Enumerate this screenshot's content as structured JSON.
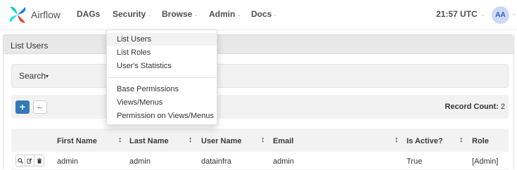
{
  "app": {
    "brand": "Airflow",
    "accent_color": "#017cee"
  },
  "navbar": {
    "items": [
      {
        "label": "DAGs",
        "caret": false
      },
      {
        "label": "Security",
        "caret": true
      },
      {
        "label": "Browse",
        "caret": true
      },
      {
        "label": "Admin",
        "caret": true
      },
      {
        "label": "Docs",
        "caret": true
      }
    ],
    "clock": "21:57 UTC",
    "user_initials": "AA"
  },
  "security_menu": {
    "items": [
      "List Users",
      "List Roles",
      "User's Statistics",
      "Base Permissions",
      "Views/Menus",
      "Permission on Views/Menus"
    ],
    "highlighted": "List Users"
  },
  "page": {
    "title": "List Users",
    "search_label": "Search",
    "add_icon": "plus-icon",
    "back_icon": "arrow-left-icon",
    "record_count_label": "Record Count:",
    "record_count": "2"
  },
  "table": {
    "columns": [
      "First Name",
      "Last Name",
      "User Name",
      "Email",
      "Is Active?",
      "Role"
    ],
    "rows": [
      {
        "first_name": "admin",
        "last_name": "admin",
        "user_name": "datainfra",
        "email": "admin",
        "is_active": "True",
        "role": "[Admin]"
      }
    ]
  }
}
